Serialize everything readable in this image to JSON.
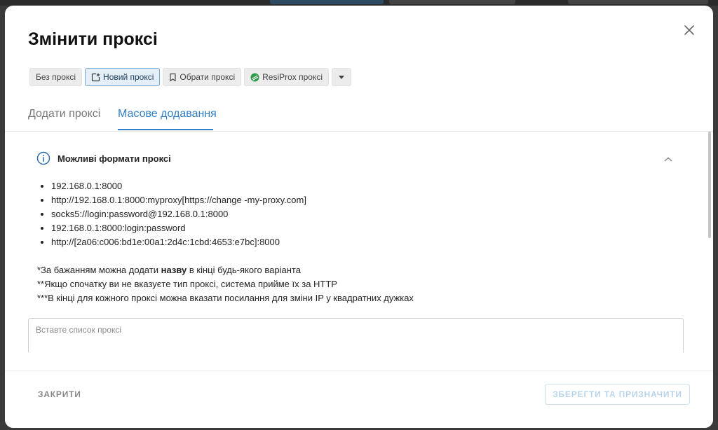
{
  "dialog": {
    "title": "Змінити проксі",
    "close_label": "×"
  },
  "proxy_options": {
    "no_proxy": "Без проксі",
    "new_proxy": "Новий проксі",
    "choose_proxy": "Обрати проксі",
    "resiprox": "ResiProx проксі"
  },
  "tabs": {
    "add": "Додати проксі",
    "bulk": "Масове додавання"
  },
  "info": {
    "title": "Можливі формати проксі",
    "formats": [
      "192.168.0.1:8000",
      "http://192.168.0.1:8000:myproxy[https://change -my-proxy.com]",
      "socks5://login:password@192.168.0.1:8000",
      "192.168.0.1:8000:login:password",
      "http://[2a06:c006:bd1e:00a1:2d4c:1cbd:4653:e7bc]:8000"
    ],
    "note1_prefix": "*За бажанням можна додати ",
    "note1_bold": "назву",
    "note1_suffix": " в кінці будь-якого варіанта",
    "note2": "**Якщо спочатку ви не вказуєте тип проксі, система прийме їх за HTTP",
    "note3": "***В кінці для кожного проксі можна вказати посилання для зміни IP у квадратних дужках"
  },
  "textarea": {
    "placeholder": "Вставте список проксі",
    "value": ""
  },
  "footer": {
    "close": "ЗАКРИТИ",
    "save": "ЗБЕРЕГТИ ТА ПРИЗНАЧИТИ"
  },
  "colors": {
    "accent": "#2f7fc6",
    "chip_bg": "#ececec",
    "resiprox_green": "#2e9c4a"
  },
  "icons": {
    "close": "close-icon",
    "new_proxy": "add-square-icon",
    "choose_proxy": "bookmark-icon",
    "resiprox": "resiprox-logo-icon",
    "dropdown": "caret-down-icon",
    "info": "info-circle-icon",
    "collapse": "chevron-up-icon"
  }
}
